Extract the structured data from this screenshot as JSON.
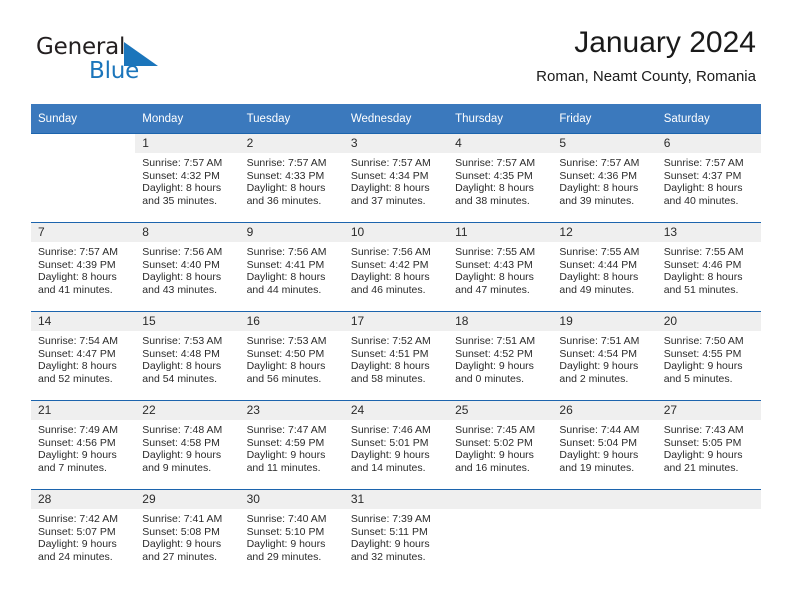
{
  "brand": {
    "name_part1": "General",
    "name_part2": "Blue",
    "logo_icon": "blue-triangle-icon",
    "accent_color": "#1b75bb"
  },
  "header": {
    "title": "January 2024",
    "subtitle": "Roman, Neamt County, Romania"
  },
  "calendar": {
    "header_bg": "#3b79bd",
    "row_divider_color": "#1c64ad",
    "daynum_band_bg": "#efefef",
    "weekday_headers": [
      "Sunday",
      "Monday",
      "Tuesday",
      "Wednesday",
      "Thursday",
      "Friday",
      "Saturday"
    ],
    "weeks": [
      [
        {
          "day": "",
          "blank": true
        },
        {
          "day": "1",
          "sunrise": "Sunrise: 7:57 AM",
          "sunset": "Sunset: 4:32 PM",
          "daylight_line1": "Daylight: 8 hours",
          "daylight_line2": "and 35 minutes."
        },
        {
          "day": "2",
          "sunrise": "Sunrise: 7:57 AM",
          "sunset": "Sunset: 4:33 PM",
          "daylight_line1": "Daylight: 8 hours",
          "daylight_line2": "and 36 minutes."
        },
        {
          "day": "3",
          "sunrise": "Sunrise: 7:57 AM",
          "sunset": "Sunset: 4:34 PM",
          "daylight_line1": "Daylight: 8 hours",
          "daylight_line2": "and 37 minutes."
        },
        {
          "day": "4",
          "sunrise": "Sunrise: 7:57 AM",
          "sunset": "Sunset: 4:35 PM",
          "daylight_line1": "Daylight: 8 hours",
          "daylight_line2": "and 38 minutes."
        },
        {
          "day": "5",
          "sunrise": "Sunrise: 7:57 AM",
          "sunset": "Sunset: 4:36 PM",
          "daylight_line1": "Daylight: 8 hours",
          "daylight_line2": "and 39 minutes."
        },
        {
          "day": "6",
          "sunrise": "Sunrise: 7:57 AM",
          "sunset": "Sunset: 4:37 PM",
          "daylight_line1": "Daylight: 8 hours",
          "daylight_line2": "and 40 minutes."
        }
      ],
      [
        {
          "day": "7",
          "sunrise": "Sunrise: 7:57 AM",
          "sunset": "Sunset: 4:39 PM",
          "daylight_line1": "Daylight: 8 hours",
          "daylight_line2": "and 41 minutes."
        },
        {
          "day": "8",
          "sunrise": "Sunrise: 7:56 AM",
          "sunset": "Sunset: 4:40 PM",
          "daylight_line1": "Daylight: 8 hours",
          "daylight_line2": "and 43 minutes."
        },
        {
          "day": "9",
          "sunrise": "Sunrise: 7:56 AM",
          "sunset": "Sunset: 4:41 PM",
          "daylight_line1": "Daylight: 8 hours",
          "daylight_line2": "and 44 minutes."
        },
        {
          "day": "10",
          "sunrise": "Sunrise: 7:56 AM",
          "sunset": "Sunset: 4:42 PM",
          "daylight_line1": "Daylight: 8 hours",
          "daylight_line2": "and 46 minutes."
        },
        {
          "day": "11",
          "sunrise": "Sunrise: 7:55 AM",
          "sunset": "Sunset: 4:43 PM",
          "daylight_line1": "Daylight: 8 hours",
          "daylight_line2": "and 47 minutes."
        },
        {
          "day": "12",
          "sunrise": "Sunrise: 7:55 AM",
          "sunset": "Sunset: 4:44 PM",
          "daylight_line1": "Daylight: 8 hours",
          "daylight_line2": "and 49 minutes."
        },
        {
          "day": "13",
          "sunrise": "Sunrise: 7:55 AM",
          "sunset": "Sunset: 4:46 PM",
          "daylight_line1": "Daylight: 8 hours",
          "daylight_line2": "and 51 minutes."
        }
      ],
      [
        {
          "day": "14",
          "sunrise": "Sunrise: 7:54 AM",
          "sunset": "Sunset: 4:47 PM",
          "daylight_line1": "Daylight: 8 hours",
          "daylight_line2": "and 52 minutes."
        },
        {
          "day": "15",
          "sunrise": "Sunrise: 7:53 AM",
          "sunset": "Sunset: 4:48 PM",
          "daylight_line1": "Daylight: 8 hours",
          "daylight_line2": "and 54 minutes."
        },
        {
          "day": "16",
          "sunrise": "Sunrise: 7:53 AM",
          "sunset": "Sunset: 4:50 PM",
          "daylight_line1": "Daylight: 8 hours",
          "daylight_line2": "and 56 minutes."
        },
        {
          "day": "17",
          "sunrise": "Sunrise: 7:52 AM",
          "sunset": "Sunset: 4:51 PM",
          "daylight_line1": "Daylight: 8 hours",
          "daylight_line2": "and 58 minutes."
        },
        {
          "day": "18",
          "sunrise": "Sunrise: 7:51 AM",
          "sunset": "Sunset: 4:52 PM",
          "daylight_line1": "Daylight: 9 hours",
          "daylight_line2": "and 0 minutes."
        },
        {
          "day": "19",
          "sunrise": "Sunrise: 7:51 AM",
          "sunset": "Sunset: 4:54 PM",
          "daylight_line1": "Daylight: 9 hours",
          "daylight_line2": "and 2 minutes."
        },
        {
          "day": "20",
          "sunrise": "Sunrise: 7:50 AM",
          "sunset": "Sunset: 4:55 PM",
          "daylight_line1": "Daylight: 9 hours",
          "daylight_line2": "and 5 minutes."
        }
      ],
      [
        {
          "day": "21",
          "sunrise": "Sunrise: 7:49 AM",
          "sunset": "Sunset: 4:56 PM",
          "daylight_line1": "Daylight: 9 hours",
          "daylight_line2": "and 7 minutes."
        },
        {
          "day": "22",
          "sunrise": "Sunrise: 7:48 AM",
          "sunset": "Sunset: 4:58 PM",
          "daylight_line1": "Daylight: 9 hours",
          "daylight_line2": "and 9 minutes."
        },
        {
          "day": "23",
          "sunrise": "Sunrise: 7:47 AM",
          "sunset": "Sunset: 4:59 PM",
          "daylight_line1": "Daylight: 9 hours",
          "daylight_line2": "and 11 minutes."
        },
        {
          "day": "24",
          "sunrise": "Sunrise: 7:46 AM",
          "sunset": "Sunset: 5:01 PM",
          "daylight_line1": "Daylight: 9 hours",
          "daylight_line2": "and 14 minutes."
        },
        {
          "day": "25",
          "sunrise": "Sunrise: 7:45 AM",
          "sunset": "Sunset: 5:02 PM",
          "daylight_line1": "Daylight: 9 hours",
          "daylight_line2": "and 16 minutes."
        },
        {
          "day": "26",
          "sunrise": "Sunrise: 7:44 AM",
          "sunset": "Sunset: 5:04 PM",
          "daylight_line1": "Daylight: 9 hours",
          "daylight_line2": "and 19 minutes."
        },
        {
          "day": "27",
          "sunrise": "Sunrise: 7:43 AM",
          "sunset": "Sunset: 5:05 PM",
          "daylight_line1": "Daylight: 9 hours",
          "daylight_line2": "and 21 minutes."
        }
      ],
      [
        {
          "day": "28",
          "sunrise": "Sunrise: 7:42 AM",
          "sunset": "Sunset: 5:07 PM",
          "daylight_line1": "Daylight: 9 hours",
          "daylight_line2": "and 24 minutes."
        },
        {
          "day": "29",
          "sunrise": "Sunrise: 7:41 AM",
          "sunset": "Sunset: 5:08 PM",
          "daylight_line1": "Daylight: 9 hours",
          "daylight_line2": "and 27 minutes."
        },
        {
          "day": "30",
          "sunrise": "Sunrise: 7:40 AM",
          "sunset": "Sunset: 5:10 PM",
          "daylight_line1": "Daylight: 9 hours",
          "daylight_line2": "and 29 minutes."
        },
        {
          "day": "31",
          "sunrise": "Sunrise: 7:39 AM",
          "sunset": "Sunset: 5:11 PM",
          "daylight_line1": "Daylight: 9 hours",
          "daylight_line2": "and 32 minutes."
        },
        {
          "day": "",
          "empty": true
        },
        {
          "day": "",
          "empty": true
        },
        {
          "day": "",
          "empty": true
        }
      ]
    ]
  }
}
